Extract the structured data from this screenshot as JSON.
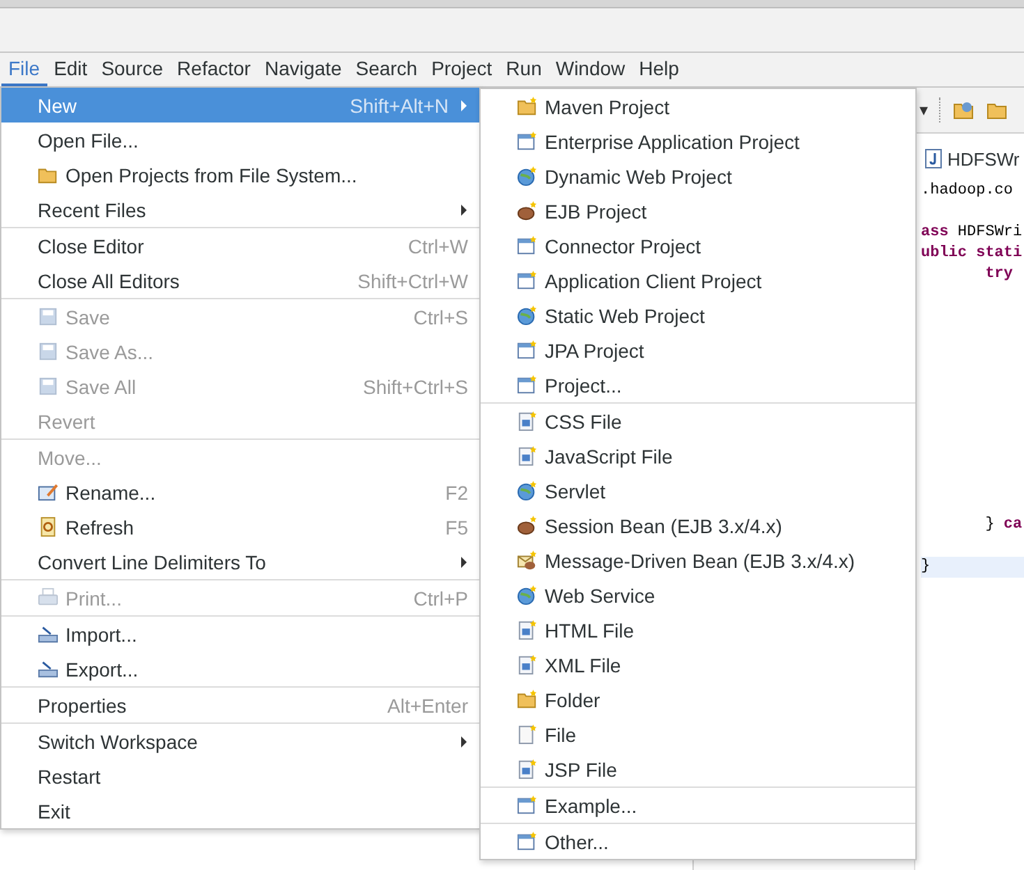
{
  "menubar": [
    {
      "label": "File",
      "selected": true
    },
    {
      "label": "Edit",
      "selected": false
    },
    {
      "label": "Source",
      "selected": false
    },
    {
      "label": "Refactor",
      "selected": false
    },
    {
      "label": "Navigate",
      "selected": false
    },
    {
      "label": "Search",
      "selected": false
    },
    {
      "label": "Project",
      "selected": false
    },
    {
      "label": "Run",
      "selected": false
    },
    {
      "label": "Window",
      "selected": false
    },
    {
      "label": "Help",
      "selected": false
    }
  ],
  "file_menu": [
    [
      {
        "label": "New",
        "shortcut": "Shift+Alt+N",
        "submenu": true,
        "selected": true,
        "disabled": false
      },
      {
        "label": "Open File...",
        "submenu": false,
        "selected": false,
        "disabled": false
      },
      {
        "label": "Open Projects from File System...",
        "submenu": false,
        "selected": false,
        "disabled": false
      },
      {
        "label": "Recent Files",
        "submenu": true,
        "selected": false,
        "disabled": false
      }
    ],
    [
      {
        "label": "Close Editor",
        "shortcut": "Ctrl+W",
        "submenu": false,
        "selected": false,
        "disabled": false
      },
      {
        "label": "Close All Editors",
        "shortcut": "Shift+Ctrl+W",
        "submenu": false,
        "selected": false,
        "disabled": false
      }
    ],
    [
      {
        "label": "Save",
        "shortcut": "Ctrl+S",
        "submenu": false,
        "selected": false,
        "disabled": true
      },
      {
        "label": "Save As...",
        "submenu": false,
        "selected": false,
        "disabled": true
      },
      {
        "label": "Save All",
        "shortcut": "Shift+Ctrl+S",
        "submenu": false,
        "selected": false,
        "disabled": true
      },
      {
        "label": "Revert",
        "submenu": false,
        "selected": false,
        "disabled": true
      }
    ],
    [
      {
        "label": "Move...",
        "submenu": false,
        "selected": false,
        "disabled": true
      },
      {
        "label": "Rename...",
        "shortcut": "F2",
        "submenu": false,
        "selected": false,
        "disabled": false
      },
      {
        "label": "Refresh",
        "shortcut": "F5",
        "submenu": false,
        "selected": false,
        "disabled": false
      },
      {
        "label": "Convert Line Delimiters To",
        "submenu": true,
        "selected": false,
        "disabled": false
      }
    ],
    [
      {
        "label": "Print...",
        "shortcut": "Ctrl+P",
        "submenu": false,
        "selected": false,
        "disabled": true
      }
    ],
    [
      {
        "label": "Import...",
        "submenu": false,
        "selected": false,
        "disabled": false
      },
      {
        "label": "Export...",
        "submenu": false,
        "selected": false,
        "disabled": false
      }
    ],
    [
      {
        "label": "Properties",
        "shortcut": "Alt+Enter",
        "submenu": false,
        "selected": false,
        "disabled": false
      }
    ],
    [
      {
        "label": "Switch Workspace",
        "submenu": true,
        "selected": false,
        "disabled": false
      },
      {
        "label": "Restart",
        "submenu": false,
        "selected": false,
        "disabled": false
      },
      {
        "label": "Exit",
        "submenu": false,
        "selected": false,
        "disabled": false
      }
    ]
  ],
  "new_submenu": [
    [
      {
        "label": "Maven Project"
      },
      {
        "label": "Enterprise Application Project"
      },
      {
        "label": "Dynamic Web Project"
      },
      {
        "label": "EJB Project"
      },
      {
        "label": "Connector Project"
      },
      {
        "label": "Application Client Project"
      },
      {
        "label": "Static Web Project"
      },
      {
        "label": "JPA Project"
      },
      {
        "label": "Project..."
      }
    ],
    [
      {
        "label": "CSS File"
      },
      {
        "label": "JavaScript File"
      },
      {
        "label": "Servlet"
      },
      {
        "label": "Session Bean (EJB 3.x/4.x)"
      },
      {
        "label": "Message-Driven Bean (EJB 3.x/4.x)"
      },
      {
        "label": "Web Service"
      },
      {
        "label": "HTML File"
      },
      {
        "label": "XML File"
      },
      {
        "label": "Folder"
      },
      {
        "label": "File"
      },
      {
        "label": "JSP File"
      }
    ],
    [
      {
        "label": "Example..."
      }
    ],
    [
      {
        "label": "Other..."
      }
    ]
  ],
  "toolbar": {
    "dropdown_arrow": "▾"
  },
  "editor": {
    "tab": "HDFSWr",
    "lines": [
      {
        "current": false,
        "segments": [
          {
            "text": ".hadoop.co",
            "keyword": false
          }
        ]
      },
      {
        "current": false,
        "segments": [
          {
            "text": "ass",
            "keyword": true
          },
          {
            "text": " HDFSWri",
            "keyword": false
          }
        ]
      },
      {
        "current": false,
        "segments": [
          {
            "text": "ublic stati",
            "keyword": true
          }
        ]
      },
      {
        "current": false,
        "segments": [
          {
            "text": "       try",
            "keyword": true
          }
        ]
      },
      {
        "current": false,
        "segments": [
          {
            "text": "       } ",
            "keyword": false
          },
          {
            "text": "ca",
            "keyword": true
          }
        ]
      },
      {
        "current": true,
        "segments": [
          {
            "text": "}",
            "keyword": false
          }
        ]
      }
    ]
  }
}
